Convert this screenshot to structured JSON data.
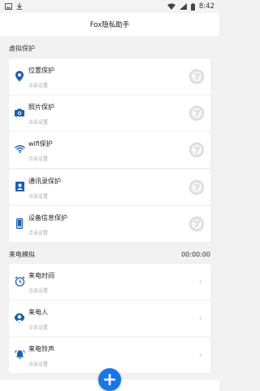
{
  "status_bar": {
    "time": "8:42"
  },
  "app_bar": {
    "title": "Fox隐私助手"
  },
  "section_virtual": {
    "label": "虚拟保护"
  },
  "virtual_items": [
    {
      "title": "位置保护",
      "subtitle": "点击设置",
      "icon": "location-pin-icon"
    },
    {
      "title": "照片保护",
      "subtitle": "点击设置",
      "icon": "camera-icon"
    },
    {
      "title": "wifi保护",
      "subtitle": "点击设置",
      "icon": "wifi-icon"
    },
    {
      "title": "通讯录保护",
      "subtitle": "点击设置",
      "icon": "contacts-icon"
    },
    {
      "title": "设备信息保护",
      "subtitle": "点击设置",
      "icon": "phone-icon"
    }
  ],
  "section_call": {
    "label": "来电模拟",
    "value": "00:00:00"
  },
  "call_items": [
    {
      "title": "来电时间",
      "subtitle": "点击设置",
      "icon": "alarm-clock-icon"
    },
    {
      "title": "来电人",
      "subtitle": "点击设置",
      "icon": "person-icon"
    },
    {
      "title": "来电铃声",
      "subtitle": "点击设置",
      "icon": "bell-icon"
    }
  ],
  "colors": {
    "accent": "#1976e6",
    "background": "#f1f1f1",
    "card": "#ffffff"
  }
}
